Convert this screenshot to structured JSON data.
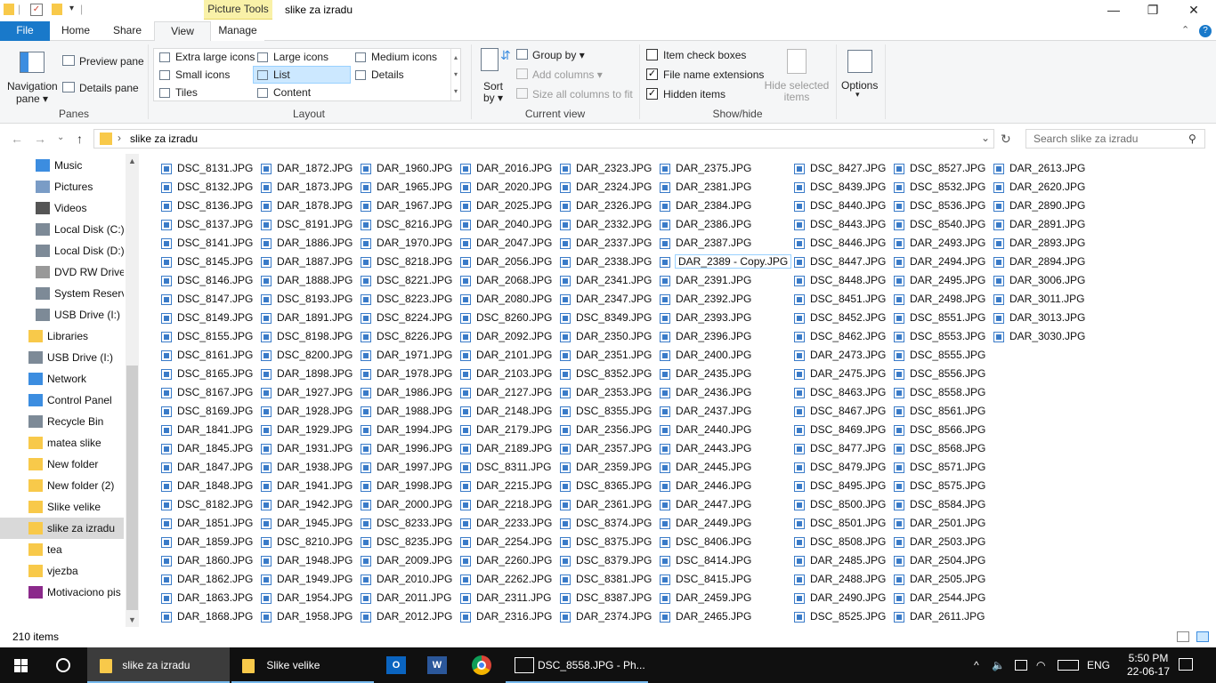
{
  "titlebar": {
    "context_tab": "Picture Tools",
    "title": "slike za izradu",
    "minimize": "—",
    "restore": "❐",
    "close": "✕"
  },
  "tabs": {
    "file": "File",
    "home": "Home",
    "share": "Share",
    "view": "View",
    "manage": "Manage"
  },
  "ribbon": {
    "panes": {
      "group_label": "Panes",
      "navigation_pane": [
        "Navigation",
        "pane ▾"
      ],
      "preview_pane": "Preview pane",
      "details_pane": "Details pane"
    },
    "layout": {
      "group_label": "Layout",
      "extra_large_icons": "Extra large icons",
      "large_icons": "Large icons",
      "medium_icons": "Medium icons",
      "small_icons": "Small icons",
      "list": "List",
      "details": "Details",
      "tiles": "Tiles",
      "content": "Content"
    },
    "current_view": {
      "group_label": "Current view",
      "sort_by": [
        "Sort",
        "by ▾"
      ],
      "group_by": "Group by ▾",
      "add_columns": "Add columns ▾",
      "size_all_columns": "Size all columns to fit"
    },
    "show_hide": {
      "group_label": "Show/hide",
      "item_check_boxes": "Item check boxes",
      "file_name_extensions": "File name extensions",
      "hidden_items": "Hidden items",
      "item_check_boxes_checked": false,
      "file_name_extensions_checked": true,
      "hidden_items_checked": true,
      "hide_selected_items": [
        "Hide selected",
        "items"
      ]
    },
    "options": "Options",
    "options_arrow": "▾"
  },
  "address": {
    "back": "←",
    "forward": "→",
    "dropdown": "⌄",
    "up": "↑",
    "breadcrumb_separator": "›",
    "path": "slike za izradu",
    "path_dropdown": "⌄",
    "refresh": "↻",
    "search_placeholder": "Search slike za izradu"
  },
  "sidebar": {
    "items": [
      {
        "label": "Music",
        "icon": "music-icon"
      },
      {
        "label": "Pictures",
        "icon": "pictures-icon"
      },
      {
        "label": "Videos",
        "icon": "videos-icon"
      },
      {
        "label": "Local Disk (C:)",
        "icon": "drive-icon"
      },
      {
        "label": "Local Disk (D:)",
        "icon": "drive-icon"
      },
      {
        "label": "DVD RW Drive",
        "icon": "dvd-icon"
      },
      {
        "label": "System Reserve",
        "icon": "drive-icon"
      },
      {
        "label": "USB Drive (I:)",
        "icon": "usb-icon"
      },
      {
        "label": "Libraries",
        "icon": "libraries-icon"
      },
      {
        "label": "USB Drive (I:)",
        "icon": "usb-icon"
      },
      {
        "label": "Network",
        "icon": "network-icon"
      },
      {
        "label": "Control Panel",
        "icon": "control-panel-icon"
      },
      {
        "label": "Recycle Bin",
        "icon": "recycle-bin-icon"
      },
      {
        "label": "matea slike",
        "icon": "folder-icon"
      },
      {
        "label": "New folder",
        "icon": "folder-icon"
      },
      {
        "label": "New folder (2)",
        "icon": "folder-icon"
      },
      {
        "label": "Slike velike",
        "icon": "folder-icon"
      },
      {
        "label": "slike za izradu",
        "icon": "folder-icon"
      },
      {
        "label": "tea",
        "icon": "folder-icon"
      },
      {
        "label": "vjezba",
        "icon": "folder-icon"
      },
      {
        "label": "Motivaciono pis",
        "icon": "winrar-icon"
      }
    ],
    "selected_index": 17,
    "scroll_up": "▲",
    "scroll_down": "▼"
  },
  "files": {
    "focused": "DAR_2389 - Copy.JPG",
    "columns": [
      [
        "DSC_8131.JPG",
        "DSC_8132.JPG",
        "DSC_8136.JPG",
        "DSC_8137.JPG",
        "DSC_8141.JPG",
        "DSC_8145.JPG",
        "DSC_8146.JPG",
        "DSC_8147.JPG",
        "DSC_8149.JPG",
        "DSC_8155.JPG",
        "DSC_8161.JPG",
        "DSC_8165.JPG",
        "DSC_8167.JPG",
        "DSC_8169.JPG",
        "DAR_1841.JPG",
        "DAR_1845.JPG",
        "DAR_1847.JPG",
        "DAR_1848.JPG",
        "DSC_8182.JPG",
        "DAR_1851.JPG",
        "DAR_1859.JPG",
        "DAR_1860.JPG",
        "DAR_1862.JPG",
        "DAR_1863.JPG",
        "DAR_1868.JPG"
      ],
      [
        "DAR_1872.JPG",
        "DAR_1873.JPG",
        "DAR_1878.JPG",
        "DSC_8191.JPG",
        "DAR_1886.JPG",
        "DAR_1887.JPG",
        "DAR_1888.JPG",
        "DSC_8193.JPG",
        "DAR_1891.JPG",
        "DSC_8198.JPG",
        "DSC_8200.JPG",
        "DAR_1898.JPG",
        "DAR_1927.JPG",
        "DAR_1928.JPG",
        "DAR_1929.JPG",
        "DAR_1931.JPG",
        "DAR_1938.JPG",
        "DAR_1941.JPG",
        "DAR_1942.JPG",
        "DAR_1945.JPG",
        "DSC_8210.JPG",
        "DAR_1948.JPG",
        "DAR_1949.JPG",
        "DAR_1954.JPG",
        "DAR_1958.JPG"
      ],
      [
        "DAR_1960.JPG",
        "DAR_1965.JPG",
        "DAR_1967.JPG",
        "DSC_8216.JPG",
        "DAR_1970.JPG",
        "DSC_8218.JPG",
        "DSC_8221.JPG",
        "DSC_8223.JPG",
        "DSC_8224.JPG",
        "DSC_8226.JPG",
        "DAR_1971.JPG",
        "DAR_1978.JPG",
        "DAR_1986.JPG",
        "DAR_1988.JPG",
        "DAR_1994.JPG",
        "DAR_1996.JPG",
        "DAR_1997.JPG",
        "DAR_1998.JPG",
        "DAR_2000.JPG",
        "DSC_8233.JPG",
        "DSC_8235.JPG",
        "DAR_2009.JPG",
        "DAR_2010.JPG",
        "DAR_2011.JPG",
        "DAR_2012.JPG"
      ],
      [
        "DAR_2016.JPG",
        "DAR_2020.JPG",
        "DAR_2025.JPG",
        "DAR_2040.JPG",
        "DAR_2047.JPG",
        "DAR_2056.JPG",
        "DAR_2068.JPG",
        "DAR_2080.JPG",
        "DSC_8260.JPG",
        "DAR_2092.JPG",
        "DAR_2101.JPG",
        "DAR_2103.JPG",
        "DAR_2127.JPG",
        "DAR_2148.JPG",
        "DAR_2179.JPG",
        "DAR_2189.JPG",
        "DSC_8311.JPG",
        "DAR_2215.JPG",
        "DAR_2218.JPG",
        "DAR_2233.JPG",
        "DAR_2254.JPG",
        "DAR_2260.JPG",
        "DAR_2262.JPG",
        "DAR_2311.JPG",
        "DAR_2316.JPG"
      ],
      [
        "DAR_2323.JPG",
        "DAR_2324.JPG",
        "DAR_2326.JPG",
        "DAR_2332.JPG",
        "DAR_2337.JPG",
        "DAR_2338.JPG",
        "DAR_2341.JPG",
        "DAR_2347.JPG",
        "DSC_8349.JPG",
        "DAR_2350.JPG",
        "DAR_2351.JPG",
        "DSC_8352.JPG",
        "DAR_2353.JPG",
        "DSC_8355.JPG",
        "DAR_2356.JPG",
        "DAR_2357.JPG",
        "DAR_2359.JPG",
        "DSC_8365.JPG",
        "DAR_2361.JPG",
        "DSC_8374.JPG",
        "DSC_8375.JPG",
        "DSC_8379.JPG",
        "DSC_8381.JPG",
        "DSC_8387.JPG",
        "DAR_2374.JPG"
      ],
      [
        "DAR_2375.JPG",
        "DAR_2381.JPG",
        "DAR_2384.JPG",
        "DAR_2386.JPG",
        "DAR_2387.JPG",
        "DAR_2389 - Copy.JPG",
        "DAR_2391.JPG",
        "DAR_2392.JPG",
        "DAR_2393.JPG",
        "DAR_2396.JPG",
        "DAR_2400.JPG",
        "DAR_2435.JPG",
        "DAR_2436.JPG",
        "DAR_2437.JPG",
        "DAR_2440.JPG",
        "DAR_2443.JPG",
        "DAR_2445.JPG",
        "DAR_2446.JPG",
        "DAR_2447.JPG",
        "DAR_2449.JPG",
        "DSC_8406.JPG",
        "DSC_8414.JPG",
        "DSC_8415.JPG",
        "DAR_2459.JPG",
        "DAR_2465.JPG"
      ],
      [
        "DSC_8427.JPG",
        "DSC_8439.JPG",
        "DSC_8440.JPG",
        "DSC_8443.JPG",
        "DSC_8446.JPG",
        "DSC_8447.JPG",
        "DSC_8448.JPG",
        "DSC_8451.JPG",
        "DSC_8452.JPG",
        "DSC_8462.JPG",
        "DAR_2473.JPG",
        "DAR_2475.JPG",
        "DSC_8463.JPG",
        "DSC_8467.JPG",
        "DSC_8469.JPG",
        "DSC_8477.JPG",
        "DSC_8479.JPG",
        "DSC_8495.JPG",
        "DSC_8500.JPG",
        "DSC_8501.JPG",
        "DSC_8508.JPG",
        "DAR_2485.JPG",
        "DAR_2488.JPG",
        "DAR_2490.JPG",
        "DSC_8525.JPG"
      ],
      [
        "DSC_8527.JPG",
        "DSC_8532.JPG",
        "DSC_8536.JPG",
        "DSC_8540.JPG",
        "DAR_2493.JPG",
        "DAR_2494.JPG",
        "DAR_2495.JPG",
        "DAR_2498.JPG",
        "DSC_8551.JPG",
        "DSC_8553.JPG",
        "DSC_8555.JPG",
        "DSC_8556.JPG",
        "DSC_8558.JPG",
        "DSC_8561.JPG",
        "DSC_8566.JPG",
        "DSC_8568.JPG",
        "DSC_8571.JPG",
        "DSC_8575.JPG",
        "DSC_8584.JPG",
        "DAR_2501.JPG",
        "DAR_2503.JPG",
        "DAR_2504.JPG",
        "DAR_2505.JPG",
        "DAR_2544.JPG",
        "DAR_2611.JPG"
      ],
      [
        "DAR_2613.JPG",
        "DAR_2620.JPG",
        "DAR_2890.JPG",
        "DAR_2891.JPG",
        "DAR_2893.JPG",
        "DAR_2894.JPG",
        "DAR_3006.JPG",
        "DAR_3011.JPG",
        "DAR_3013.JPG",
        "DAR_3030.JPG"
      ]
    ]
  },
  "status": {
    "item_count": "210 items"
  },
  "taskbar": {
    "start": "start-icon",
    "search": "search-circle-icon",
    "apps": [
      {
        "label": "slike za izradu",
        "active": true
      },
      {
        "label": "Slike velike",
        "active": false
      }
    ],
    "pinned": [
      "outlook-icon",
      "word-icon",
      "chrome-icon"
    ],
    "photos_label": "DSC_8558.JPG - Ph...",
    "tray_up": "^",
    "language": "ENG",
    "time": "5:50 PM",
    "date": "22-06-17"
  },
  "colors": {
    "accent": "#1979ca",
    "picture_tools": "#f9f1a8",
    "selection": "#cce8ff",
    "taskbar": "#101010"
  }
}
